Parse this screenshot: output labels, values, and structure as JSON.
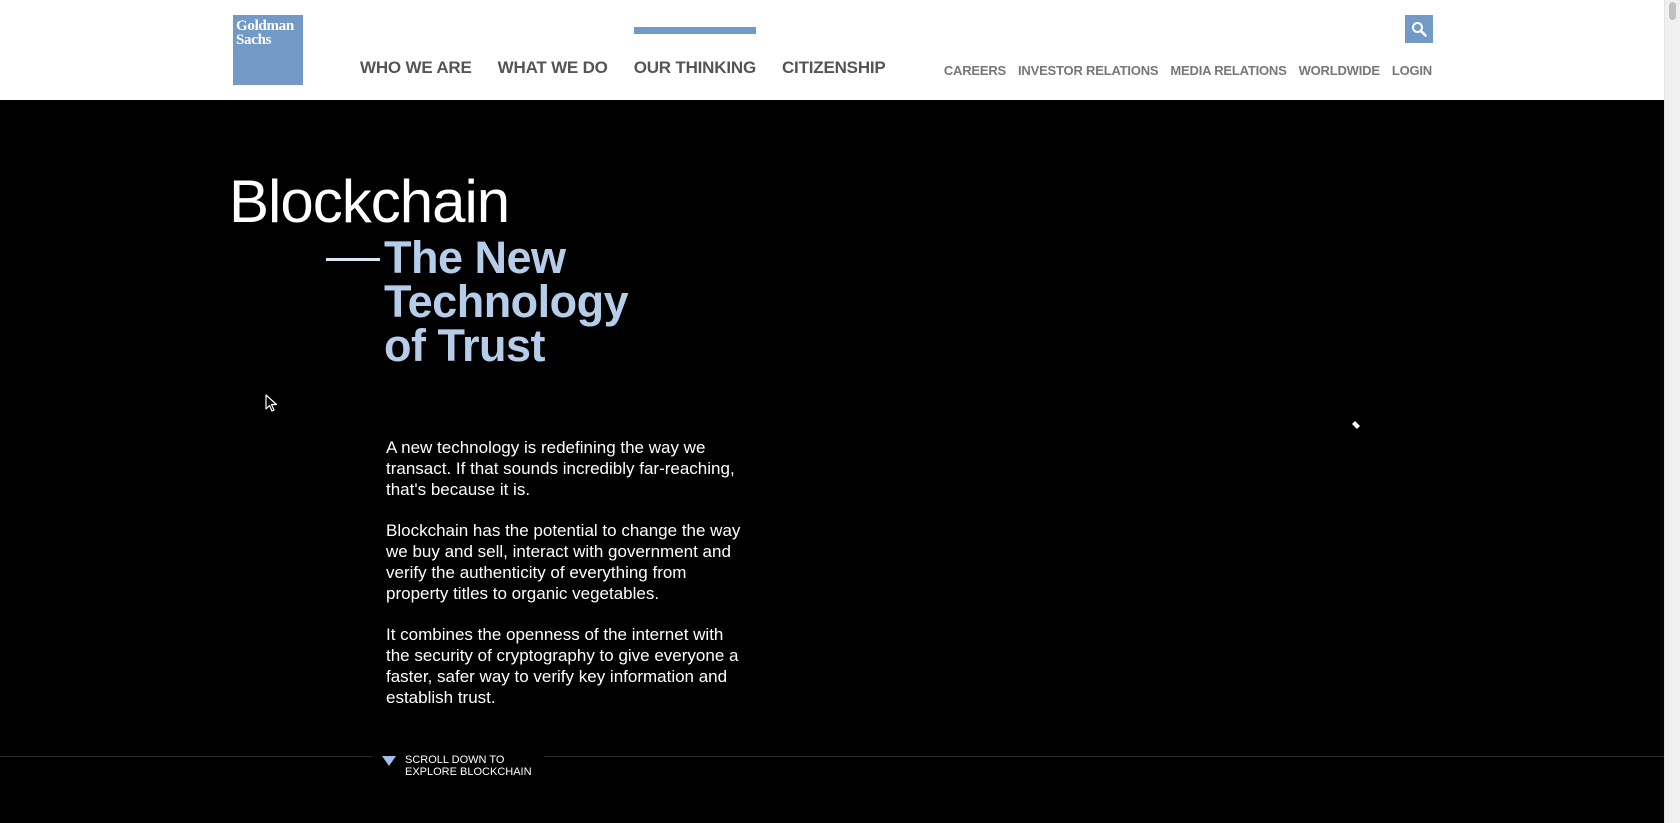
{
  "header": {
    "logo_line1": "Goldman",
    "logo_line2": "Sachs",
    "main_nav": [
      {
        "label": "WHO WE ARE"
      },
      {
        "label": "WHAT WE DO"
      },
      {
        "label": "OUR THINKING",
        "active": true
      },
      {
        "label": "CITIZENSHIP"
      }
    ],
    "util_nav": [
      {
        "label": "CAREERS"
      },
      {
        "label": "INVESTOR RELATIONS"
      },
      {
        "label": "MEDIA RELATIONS"
      },
      {
        "label": "WORLDWIDE"
      },
      {
        "label": "LOGIN"
      }
    ],
    "search_icon": "search-icon"
  },
  "hero": {
    "title": "Blockchain",
    "subtitle_line1": "The New",
    "subtitle_line2": "Technology",
    "subtitle_line3": "of Trust",
    "paragraphs": [
      "A new technology is redefining the way we transact. If that sounds incredibly far-reaching, that's because it is.",
      "Blockchain has the potential to change the way we buy and sell, interact with government and verify the authenticity of everything from property titles to organic vegetables.",
      "It combines the openness of the internet with the security of cryptography to give everyone a faster, safer way to verify key information and establish trust."
    ],
    "scroll_cta_line1": "SCROLL DOWN TO",
    "scroll_cta_line2": "EXPLORE BLOCKCHAIN"
  },
  "colors": {
    "brand_blue": "#7399c6",
    "subtitle_blue": "#b6cde9",
    "background": "#000000",
    "header_bg": "#ffffff"
  }
}
